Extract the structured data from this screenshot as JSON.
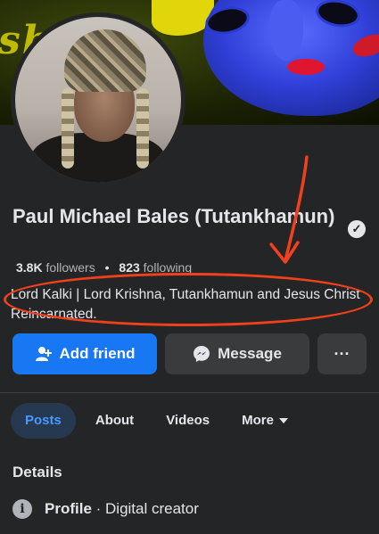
{
  "cover": {
    "text": "shy"
  },
  "profile": {
    "name": "Paul Michael Bales (Tutankhamun)",
    "followers_count": "3.8K",
    "followers_label": "followers",
    "following_count": "823",
    "following_label": "following",
    "bio": "Lord Kalki | Lord Krishna, Tutankhamun and Jesus Christ Reincarnated."
  },
  "actions": {
    "add_friend": "Add friend",
    "message": "Message",
    "more": "···"
  },
  "tabs": [
    {
      "label": "Posts",
      "active": true
    },
    {
      "label": "About",
      "active": false
    },
    {
      "label": "Videos",
      "active": false
    },
    {
      "label": "More",
      "active": false
    }
  ],
  "details": {
    "title": "Details",
    "profile_label": "Profile",
    "profile_value": " · Digital creator"
  },
  "colors": {
    "background": "#242526",
    "primary": "#1877f2",
    "annotation": "#f0401c",
    "active_tab_bg": "#263951",
    "active_tab_text": "#4599ff"
  }
}
